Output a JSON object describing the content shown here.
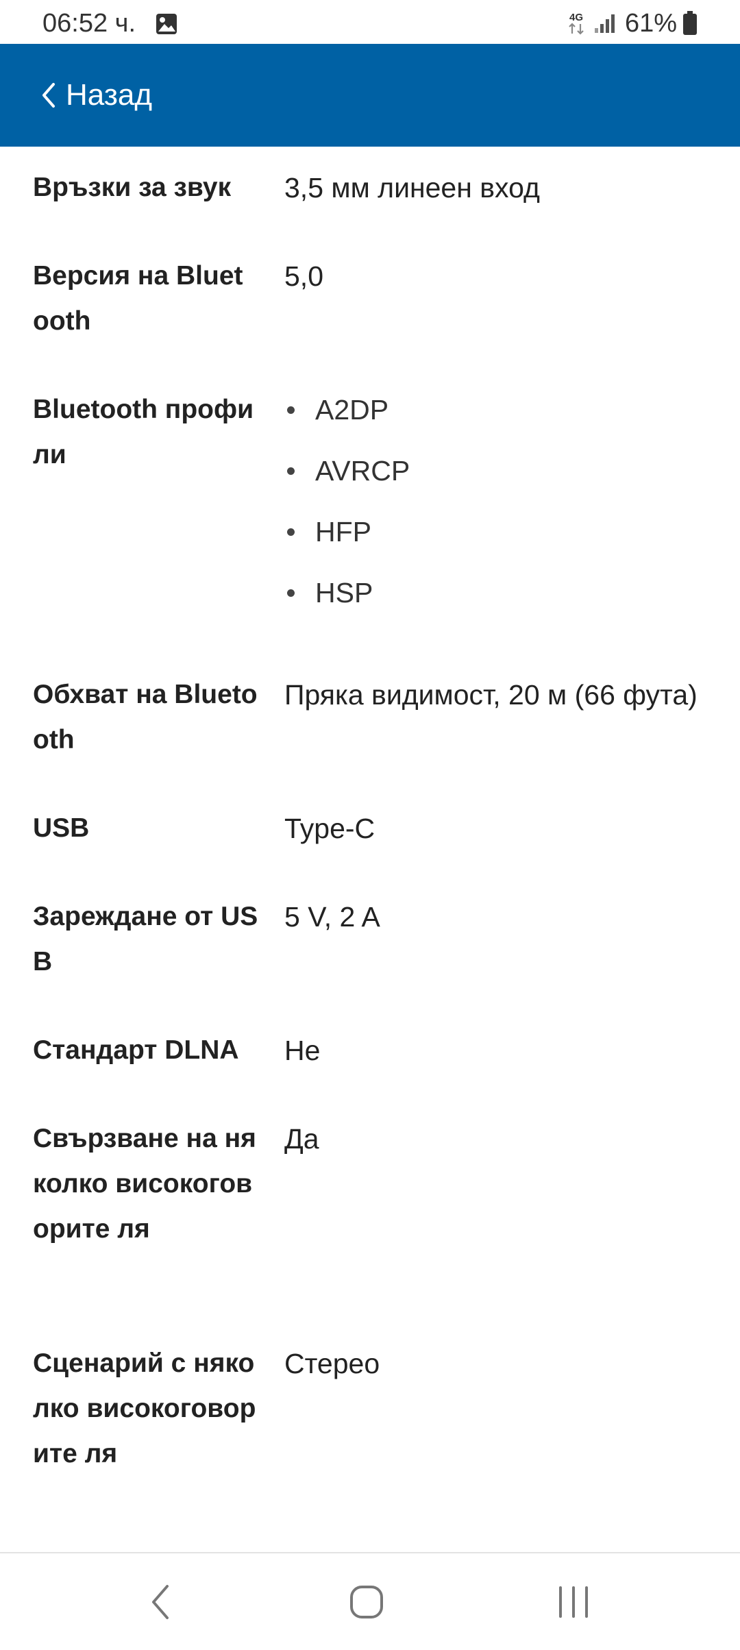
{
  "status_bar": {
    "time": "06:52 ч.",
    "network": "4G",
    "battery": "61%"
  },
  "header": {
    "back_label": "Назад",
    "background_color": "#0061a4"
  },
  "specs": [
    {
      "label": "Връзки за звук",
      "value": "3,5 мм линеен вход"
    },
    {
      "label": "Версия на Bluetooth",
      "value": "5,0"
    },
    {
      "label": "Bluetooth профили",
      "values": [
        "A2DP",
        "AVRCP",
        "HFP",
        "HSP"
      ]
    },
    {
      "label": "Обхват на Bluetooth",
      "value": "Пряка видимост, 20 м (66 фута)"
    },
    {
      "label": "USB",
      "value": "Type-C"
    },
    {
      "label": "Зареждане от USB",
      "value": "5 V, 2 A"
    },
    {
      "label": "Стандарт DLNA",
      "value": "Не"
    },
    {
      "label": "Свързване на няколко високоговорите ля",
      "value": "Да"
    },
    {
      "label": "Сценарий с няколко високоговорите ля",
      "value": "Стерео"
    }
  ],
  "icons": {
    "gallery": "image-icon",
    "signal": "signal-icon",
    "battery": "battery-icon",
    "back": "chevron-left-icon",
    "nav_back": "nav-back-icon",
    "nav_home": "nav-home-icon",
    "nav_recents": "nav-recents-icon"
  }
}
